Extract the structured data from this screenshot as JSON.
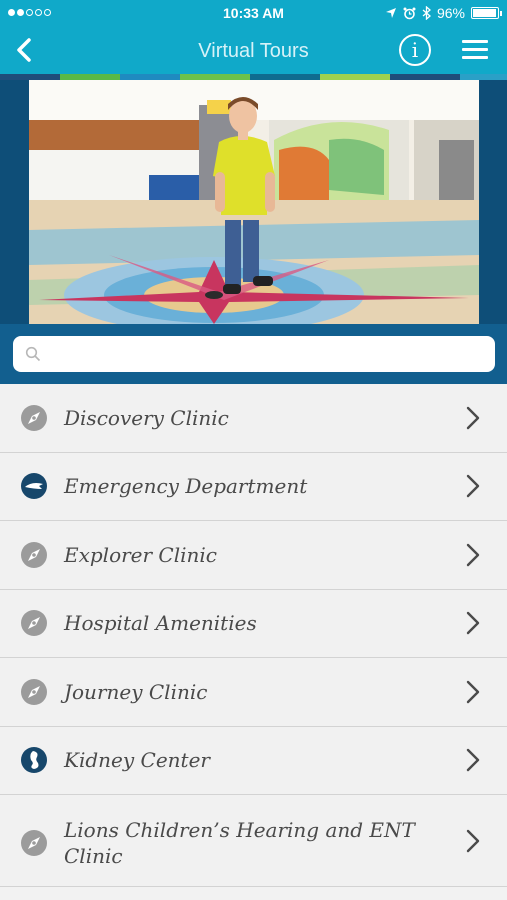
{
  "status_bar": {
    "time": "10:33 AM",
    "battery": "96%",
    "battery_level": 0.96
  },
  "nav": {
    "title": "Virtual Tours",
    "back_icon": "chevron-left-icon",
    "info_glyph": "i",
    "menu_icon": "hamburger-menu-icon"
  },
  "colors": {
    "brand": "#10a9c9",
    "dark_blue": "#125f8f",
    "icon_gray": "#9b9b9b",
    "icon_navy": "#17476b",
    "text": "#4a4a4a"
  },
  "search": {
    "placeholder": "",
    "value": ""
  },
  "tours": [
    {
      "label": "Discovery Clinic",
      "icon": "compass-icon"
    },
    {
      "label": "Emergency Department",
      "icon": "emergency-icon"
    },
    {
      "label": "Explorer Clinic",
      "icon": "compass-icon"
    },
    {
      "label": "Hospital Amenities",
      "icon": "compass-icon"
    },
    {
      "label": "Journey Clinic",
      "icon": "compass-icon"
    },
    {
      "label": "Kidney Center",
      "icon": "kidney-icon"
    },
    {
      "label": "Lions Children’s Hearing and ENT Clinic",
      "icon": "compass-icon"
    }
  ]
}
